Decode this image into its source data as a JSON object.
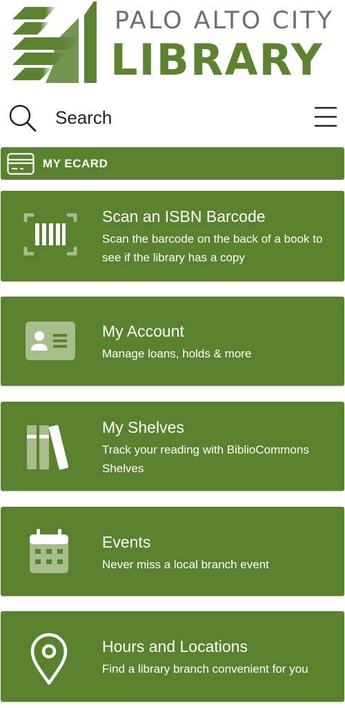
{
  "header": {
    "logo_line1": "PALO ALTO CITY",
    "logo_line2": "LIBRARY"
  },
  "search": {
    "label": "Search"
  },
  "ecard": {
    "label": "MY ECARD"
  },
  "cards": [
    {
      "icon": "barcode-scan-icon",
      "title": "Scan an ISBN Barcode",
      "desc": "Scan the barcode on the back of a book to see if the library has a copy"
    },
    {
      "icon": "id-card-icon",
      "title": "My Account",
      "desc": "Manage loans, holds & more"
    },
    {
      "icon": "bookshelf-icon",
      "title": "My Shelves",
      "desc": "Track your reading with BiblioCommons Shelves"
    },
    {
      "icon": "calendar-icon",
      "title": "Events",
      "desc": "Never miss a local branch event"
    },
    {
      "icon": "location-pin-icon",
      "title": "Hours and Locations",
      "desc": "Find a library branch convenient for you"
    }
  ],
  "colors": {
    "brand_green": "#5a812e",
    "logo_green": "#5c8232",
    "logo_gray": "#6d6e70",
    "icon_light": "#a8bc8c"
  }
}
